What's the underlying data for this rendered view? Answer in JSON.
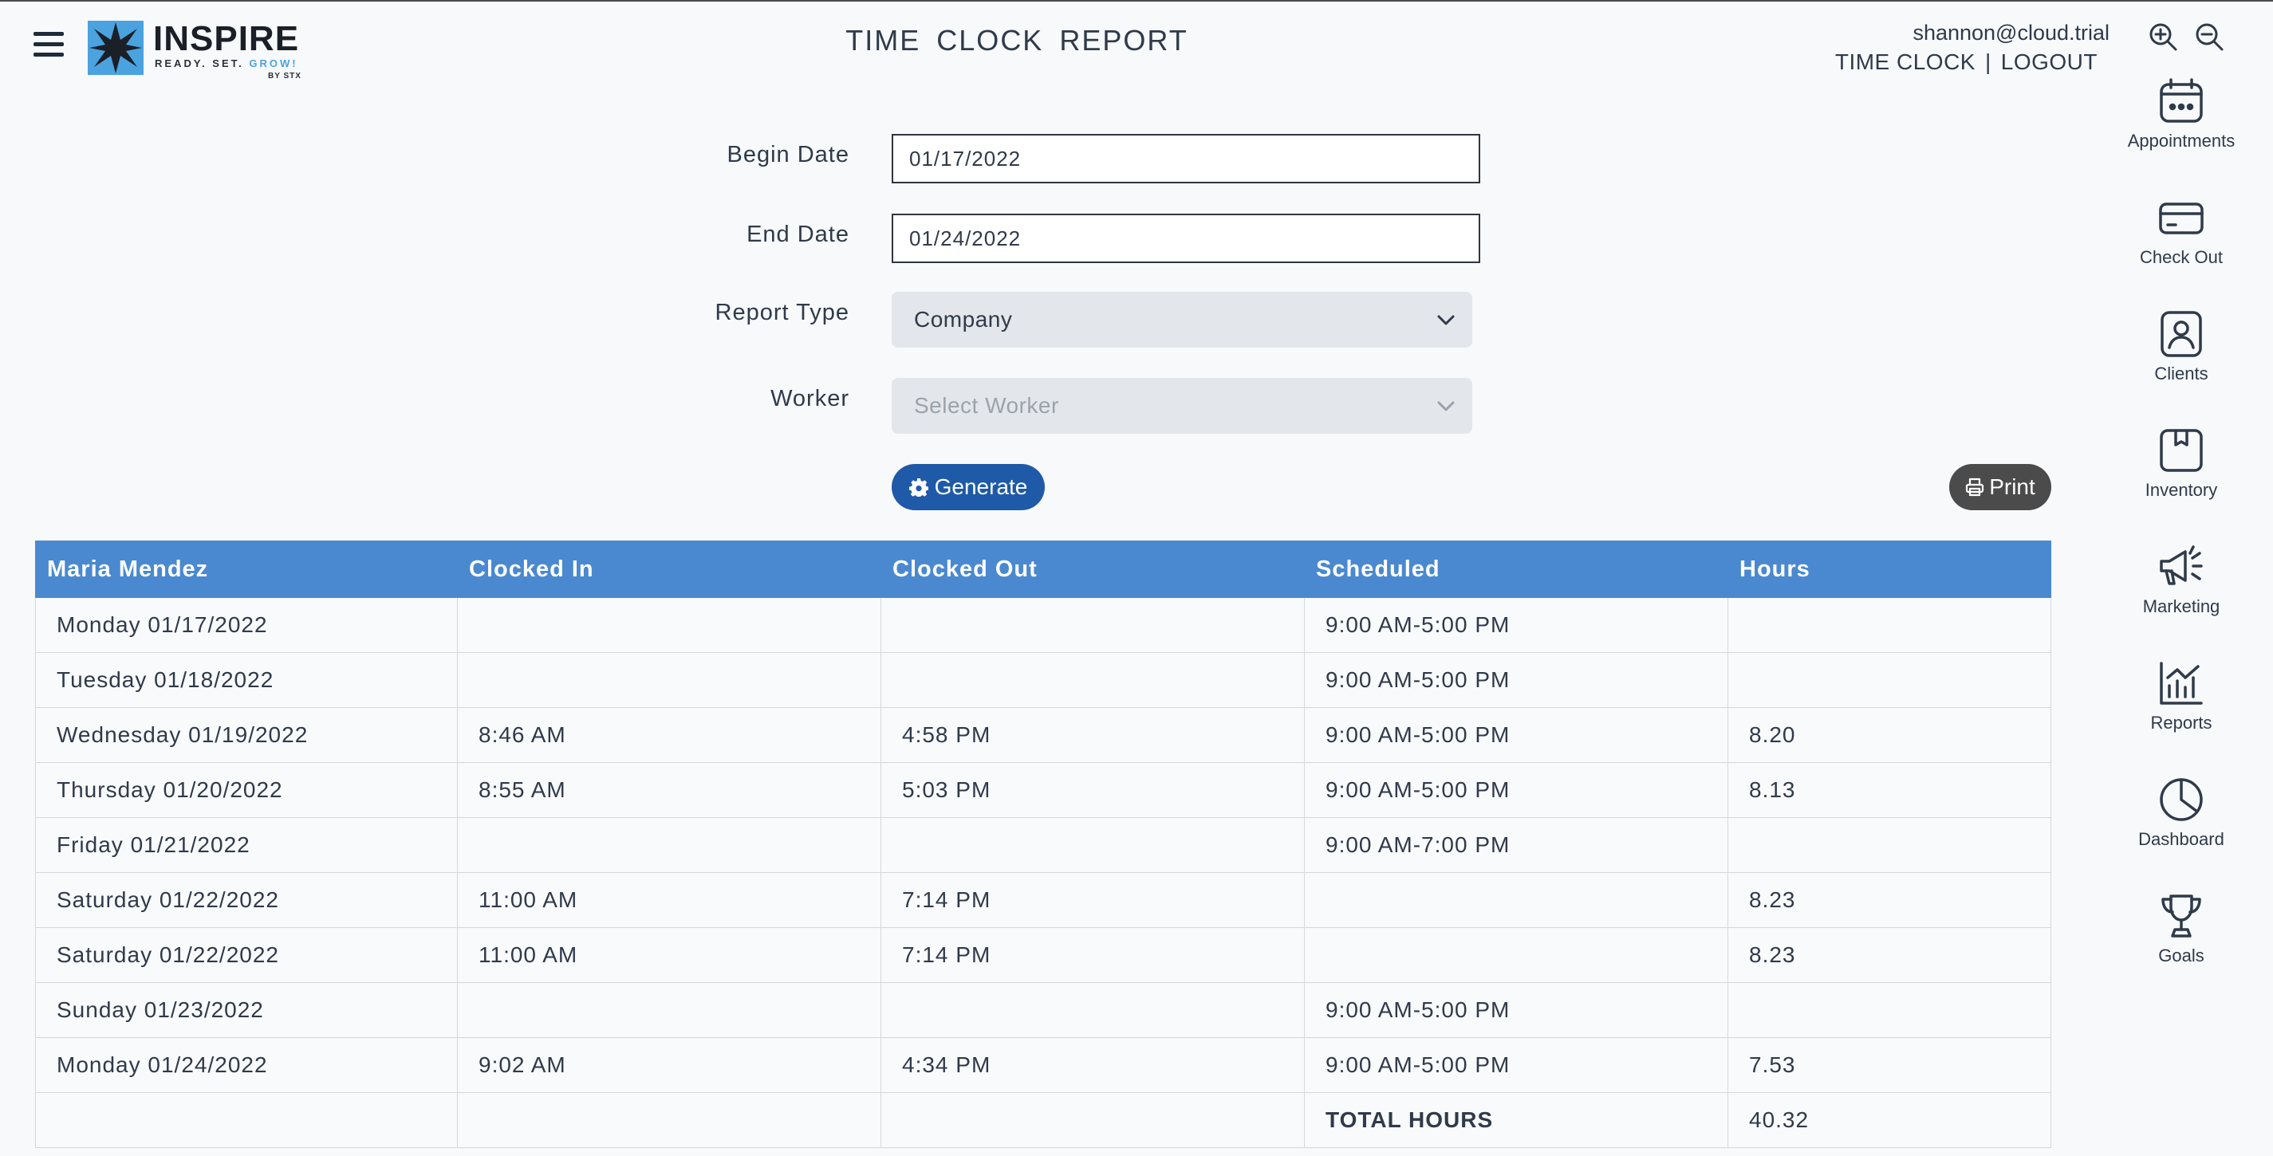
{
  "header": {
    "page_title": "TIME CLOCK REPORT",
    "user_email": "shannon@cloud.trial",
    "time_clock_link": "TIME CLOCK",
    "separator": "|",
    "logout_link": "LOGOUT"
  },
  "logo": {
    "name": "INSPIRE",
    "tag_prefix": "READY. SET. ",
    "tag_accent": "GROW!",
    "by": "BY STX",
    "colors": {
      "blue": "#4aa3df",
      "dark": "#1b1f27"
    }
  },
  "rail": [
    {
      "label": "Appointments",
      "icon": "calendar-icon"
    },
    {
      "label": "Check Out",
      "icon": "credit-card-icon"
    },
    {
      "label": "Clients",
      "icon": "user-card-icon"
    },
    {
      "label": "Inventory",
      "icon": "box-icon"
    },
    {
      "label": "Marketing",
      "icon": "megaphone-icon"
    },
    {
      "label": "Reports",
      "icon": "bar-chart-icon"
    },
    {
      "label": "Dashboard",
      "icon": "pie-chart-icon"
    },
    {
      "label": "Goals",
      "icon": "trophy-icon"
    }
  ],
  "form": {
    "begin_label": "Begin Date",
    "begin_value": "01/17/2022",
    "end_label": "End Date",
    "end_value": "01/24/2022",
    "report_type_label": "Report Type",
    "report_type_value": "Company",
    "worker_label": "Worker",
    "worker_placeholder": "Select Worker",
    "generate_label": "Generate",
    "print_label": "Print"
  },
  "table": {
    "headers": [
      "Maria Mendez",
      "Clocked In",
      "Clocked Out",
      "Scheduled",
      "Hours"
    ],
    "rows": [
      [
        "Monday 01/17/2022",
        "",
        "",
        "9:00 AM-5:00 PM",
        ""
      ],
      [
        "Tuesday 01/18/2022",
        "",
        "",
        "9:00 AM-5:00 PM",
        ""
      ],
      [
        "Wednesday 01/19/2022",
        "8:46 AM",
        "4:58 PM",
        "9:00 AM-5:00 PM",
        "8.20"
      ],
      [
        "Thursday 01/20/2022",
        "8:55 AM",
        "5:03 PM",
        "9:00 AM-5:00 PM",
        "8.13"
      ],
      [
        "Friday 01/21/2022",
        "",
        "",
        "9:00 AM-7:00 PM",
        ""
      ],
      [
        "Saturday 01/22/2022",
        "11:00 AM",
        "7:14 PM",
        "",
        "8.23"
      ],
      [
        "Saturday 01/22/2022",
        "11:00 AM",
        "7:14 PM",
        "",
        "8.23"
      ],
      [
        "Sunday 01/23/2022",
        "",
        "",
        "9:00 AM-5:00 PM",
        ""
      ],
      [
        "Monday 01/24/2022",
        "9:02 AM",
        "4:34 PM",
        "9:00 AM-5:00 PM",
        "7.53"
      ],
      [
        "",
        "",
        "",
        "TOTAL HOURS",
        "40.32"
      ]
    ]
  },
  "colors": {
    "accent": "#4a89d0",
    "generate_button": "#1e5aa8",
    "print_button": "#4b4b4b"
  }
}
